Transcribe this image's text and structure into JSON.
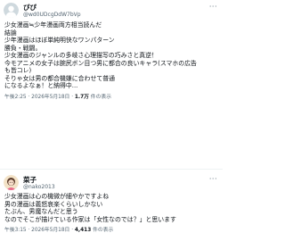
{
  "colors": {
    "text": "#0f1419",
    "secondary": "#536471",
    "divider": "#eff3f4"
  },
  "post1": {
    "display_name": "ぴぴ",
    "handle": "@wd0UDcgDdW7bVp",
    "more_icon": "more-horizontal-icon",
    "lines": [
      "少女漫画≒少年漫画両方相当読んだ",
      "結論",
      "少年漫画はほぼ単純明快なワンパターン",
      "勝負・戦闘。",
      "少女漫画のジャンルの多岐さ心理描写の巧みさと真逆！",
      "今モアニメの女子は腕尻ボン目つ男に都合の良いキャラ(スマホの広告",
      "も皆コレ)",
      "そりゃ女は男の都合機嫌に合わせて普通",
      "になるよなぁ！と納得中..."
    ],
    "timestamp": "午後2:25 · 2026年5月18日",
    "separator": " · ",
    "views": "1.7万",
    "views_label": " 件の表示"
  },
  "post2": {
    "display_name": "菜子",
    "handle": "@nako2013",
    "more_icon": "more-horizontal-icon",
    "lines": [
      "少女漫画は心の機微が細やかですよね",
      "男の漫画は義怒哀楽くらいしかない",
      "たぶん、男魔なんだと思う",
      "なのでそこが描けている作家は「女性なのでは？」と思います"
    ],
    "timestamp": "午後3:15 · 2026年5月18日",
    "separator": " · ",
    "views": "4,413",
    "views_label": " 件の表示"
  }
}
